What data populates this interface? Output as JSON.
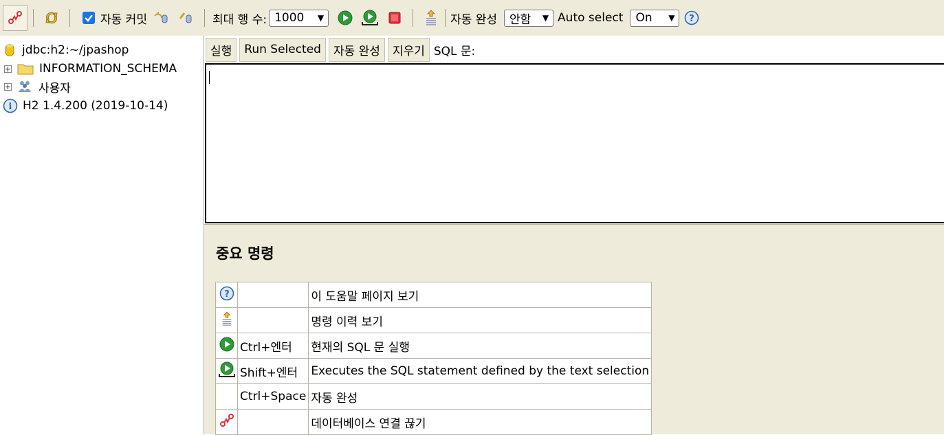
{
  "toolbar": {
    "auto_commit_label": "자동 커밋",
    "max_rows_label": "최대 행 수:",
    "max_rows_value": "1000",
    "autocomplete_label": "자동 완성",
    "autocomplete_value": "안함",
    "autoselect_label": "Auto select",
    "autoselect_value": "On",
    "icons": [
      "disconnect-icon",
      "refresh-icon",
      "rollback-icon",
      "commit-icon",
      "run-icon",
      "run-selected-icon",
      "stop-icon",
      "history-icon",
      "help-icon"
    ]
  },
  "tree": {
    "connection": "jdbc:h2:~/jpashop",
    "schema": "INFORMATION_SCHEMA",
    "users": "사용자",
    "version": "H2 1.4.200 (2019-10-14)"
  },
  "query": {
    "run": "실행",
    "run_selected": "Run Selected",
    "autocomplete": "자동 완성",
    "clear": "지우기",
    "sql_label": "SQL 문:",
    "text": ""
  },
  "help": {
    "title": "중요 명령",
    "rows": [
      {
        "icon": "help-icon",
        "key": "",
        "desc": "이 도움말 페이지 보기"
      },
      {
        "icon": "history-icon",
        "key": "",
        "desc": "명령 이력 보기"
      },
      {
        "icon": "run-icon",
        "key": "Ctrl+엔터",
        "desc": "현재의 SQL 문 실행"
      },
      {
        "icon": "run-selected-icon",
        "key": "Shift+엔터",
        "desc": "Executes the SQL statement defined by the text selection"
      },
      {
        "icon": "",
        "key": "Ctrl+Space",
        "desc": "자동 완성"
      },
      {
        "icon": "disconnect-icon",
        "key": "",
        "desc": "데이터베이스 연결 끊기"
      }
    ]
  },
  "colors": {
    "toolbar_bg": "#efebdb",
    "run_green": "#2e9a3a",
    "stop_red": "#e0303a",
    "help_blue": "#2b66b0",
    "checkbox_blue": "#1a73e8"
  }
}
